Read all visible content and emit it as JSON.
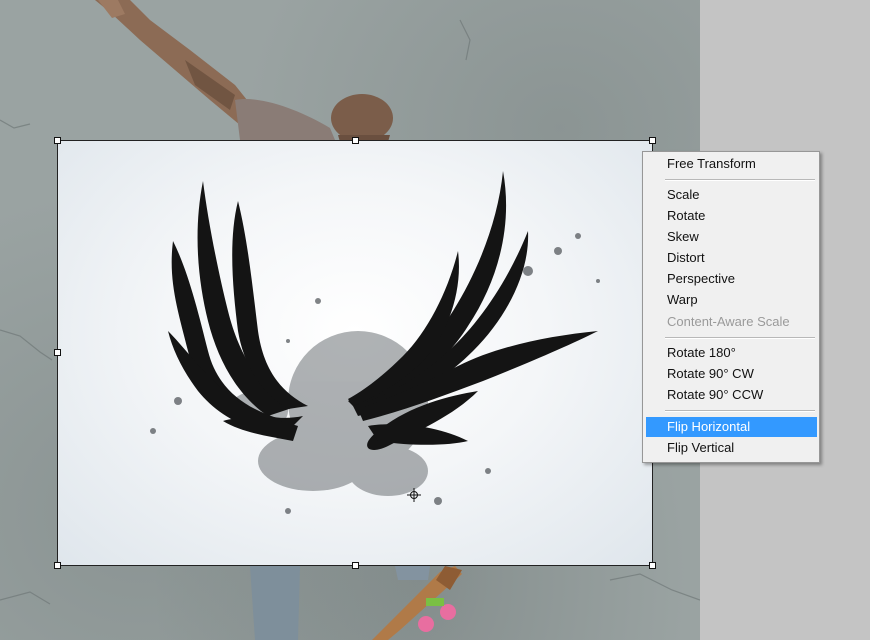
{
  "app": {
    "document": "canvas",
    "tool": "free-transform"
  },
  "context_menu": {
    "items": [
      {
        "label": "Free Transform",
        "state": "normal"
      },
      {
        "label": "Scale",
        "state": "normal"
      },
      {
        "label": "Rotate",
        "state": "normal"
      },
      {
        "label": "Skew",
        "state": "normal"
      },
      {
        "label": "Distort",
        "state": "normal"
      },
      {
        "label": "Perspective",
        "state": "normal"
      },
      {
        "label": "Warp",
        "state": "normal"
      },
      {
        "label": "Content-Aware Scale",
        "state": "disabled"
      },
      {
        "label": "Rotate 180°",
        "state": "normal"
      },
      {
        "label": "Rotate 90° CW",
        "state": "normal"
      },
      {
        "label": "Rotate 90° CCW",
        "state": "normal"
      },
      {
        "label": "Flip Horizontal",
        "state": "highlighted"
      },
      {
        "label": "Flip Vertical",
        "state": "normal"
      }
    ],
    "highlight_color": "#3399ff"
  },
  "layers": {
    "background": "concrete-wall-with-skateboarder",
    "transformed": "black-wings-splatter"
  }
}
